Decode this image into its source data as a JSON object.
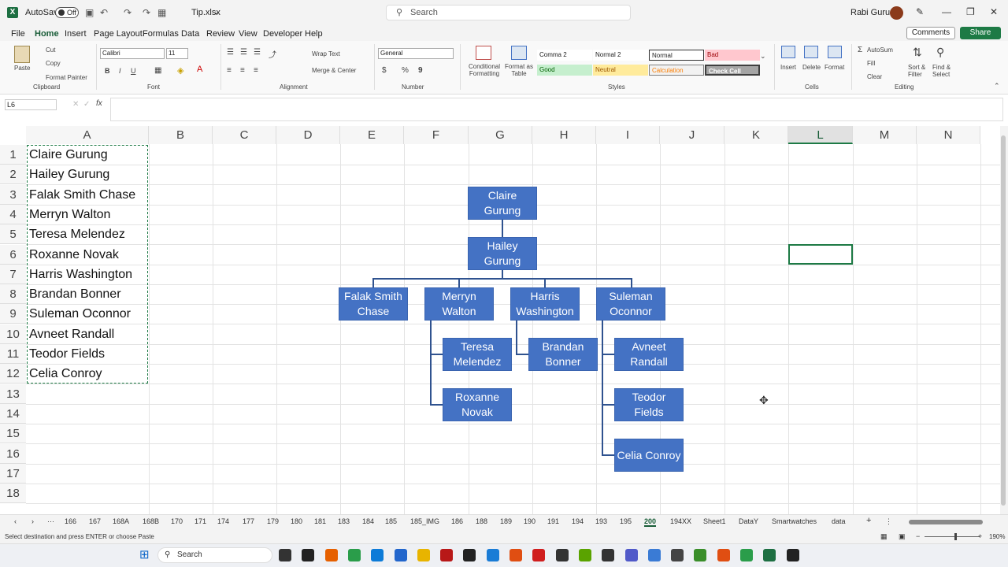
{
  "titlebar": {
    "autosave_label": "AutoSave",
    "autosave_state": "Off",
    "filename": "Tip.xlsx",
    "search_placeholder": "Search",
    "user": "Rabi Gurung"
  },
  "menu": {
    "items": [
      "File",
      "Home",
      "Insert",
      "Page Layout",
      "Formulas",
      "Data",
      "Review",
      "View",
      "Developer",
      "Help"
    ],
    "active": "Home",
    "comments": "Comments",
    "share": "Share"
  },
  "ribbon": {
    "clipboard": {
      "paste": "Paste",
      "cut": "Cut",
      "copy": "Copy",
      "format_painter": "Format Painter",
      "group": "Clipboard"
    },
    "font": {
      "name": "Calibri",
      "size": "11",
      "bold": "B",
      "italic": "I",
      "underline": "U",
      "group": "Font"
    },
    "alignment": {
      "wrap": "Wrap Text",
      "merge": "Merge & Center",
      "group": "Alignment"
    },
    "number": {
      "format": "General",
      "currency": "$",
      "percent": "%",
      "comma": "9",
      "group": "Number"
    },
    "styles": {
      "conditional": "Conditional Formatting",
      "format_table": "Format as Table",
      "cells": [
        "Comma 2",
        "Normal 2",
        "Normal",
        "Bad",
        "Good",
        "Neutral",
        "Calculation",
        "Check Cell"
      ],
      "group": "Styles"
    },
    "cells": {
      "insert": "Insert",
      "delete": "Delete",
      "format": "Format",
      "group": "Cells"
    },
    "editing": {
      "autosum": "AutoSum",
      "fill": "Fill",
      "clear": "Clear",
      "sort": "Sort & Filter",
      "find": "Find & Select",
      "group": "Editing"
    }
  },
  "formula_bar": {
    "name_box": "L6",
    "fx": "fx",
    "value": ""
  },
  "sheet": {
    "columns": [
      "A",
      "B",
      "C",
      "D",
      "E",
      "F",
      "G",
      "H",
      "I",
      "J",
      "K",
      "L",
      "M",
      "N"
    ],
    "rows": [
      "1",
      "2",
      "3",
      "4",
      "5",
      "6",
      "7",
      "8",
      "9",
      "10",
      "11",
      "12",
      "13",
      "14",
      "15",
      "16",
      "17",
      "18"
    ],
    "selected_column": "L",
    "column_a": [
      "Claire Gurung",
      "Hailey Gurung",
      "Falak Smith Chase",
      "Merryn Walton",
      "Teresa Melendez",
      "Roxanne Novak",
      "Harris Washington",
      "Brandan Bonner",
      "Suleman Oconnor",
      "Avneet Randall",
      "Teodor Fields",
      "Celia Conroy"
    ]
  },
  "org_chart": {
    "nodes": [
      "Claire Gurung",
      "Hailey Gurung",
      "Falak Smith Chase",
      "Merryn Walton",
      "Harris Washington",
      "Suleman Oconnor",
      "Teresa Melendez",
      "Roxanne Novak",
      "Brandan Bonner",
      "Avneet Randall",
      "Teodor Fields",
      "Celia Conroy"
    ],
    "fill_color": "#4472c4"
  },
  "tabs": {
    "items": [
      "166",
      "167",
      "168A",
      "168B",
      "170",
      "171",
      "174",
      "177",
      "179",
      "180",
      "181",
      "183",
      "184",
      "185",
      "185_IMG",
      "186",
      "188",
      "189",
      "190",
      "191",
      "194",
      "193",
      "195",
      "200",
      "194XX",
      "Sheet1",
      "DataY",
      "Smartwatches",
      "data"
    ],
    "active": "200"
  },
  "status": {
    "message": "Select destination and press ENTER or choose Paste",
    "zoom": "190%"
  },
  "taskbar": {
    "search": "Search"
  }
}
